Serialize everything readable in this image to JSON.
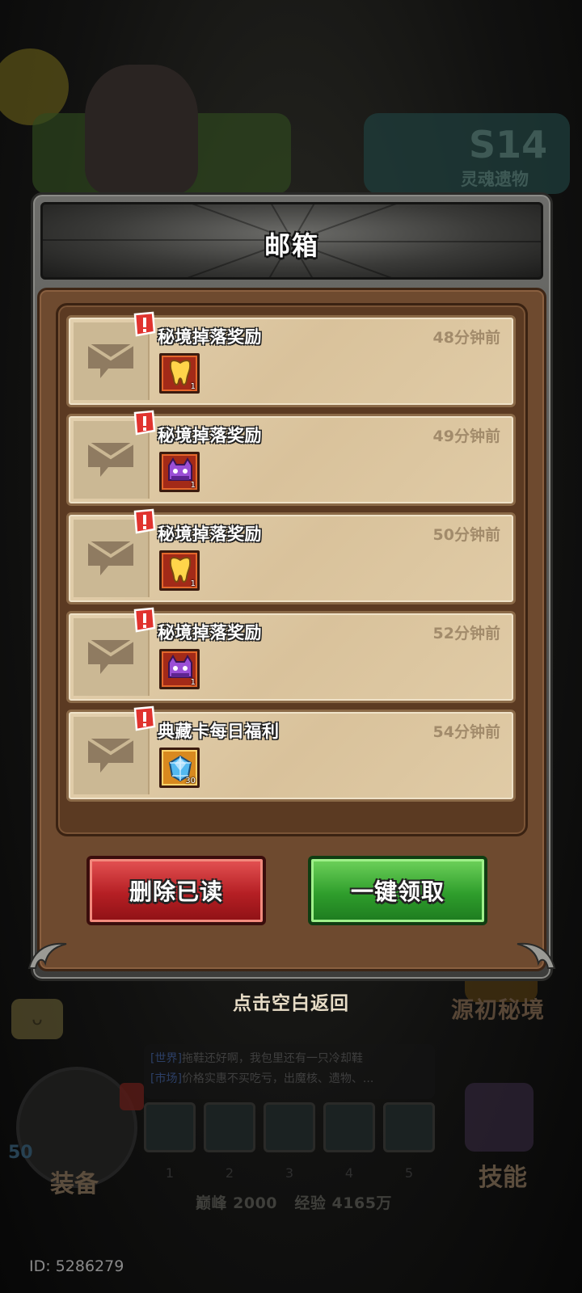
{
  "background": {
    "season": {
      "number": "S14",
      "subtitle": "灵魂遗物"
    },
    "realm_label": "源初秘境",
    "chat": [
      {
        "channel": "[世界]",
        "text": "拖鞋还好啊，我包里还有一只冷却鞋"
      },
      {
        "channel": "[市场]",
        "text": "价格实惠不买吃亏，出魔核、遗物、..."
      }
    ],
    "hero_level": "50",
    "equip_label": "装备",
    "slot_numbers": [
      "1",
      "2",
      "3",
      "4",
      "5"
    ],
    "stats": {
      "peak_label": "巅峰",
      "peak_value": "2000",
      "exp_label": "经验",
      "exp_value": "4165万"
    },
    "skill_label": "技能",
    "user_id": "ID: 5286279"
  },
  "mailbox": {
    "title": "邮箱",
    "mails": [
      {
        "title": "秘境掉落奖励",
        "time": "48分钟前",
        "reward": {
          "icon": "golden-tooth-icon",
          "count": "1",
          "frame": "red"
        }
      },
      {
        "title": "秘境掉落奖励",
        "time": "49分钟前",
        "reward": {
          "icon": "purple-cat-box-icon",
          "count": "1",
          "frame": "red"
        }
      },
      {
        "title": "秘境掉落奖励",
        "time": "50分钟前",
        "reward": {
          "icon": "golden-tooth-icon",
          "count": "1",
          "frame": "red"
        }
      },
      {
        "title": "秘境掉落奖励",
        "time": "52分钟前",
        "reward": {
          "icon": "purple-cat-box-icon",
          "count": "1",
          "frame": "red"
        }
      },
      {
        "title": "典藏卡每日福利",
        "time": "54分钟前",
        "reward": {
          "icon": "blue-gem-icon",
          "count": "30",
          "frame": "gold"
        }
      }
    ],
    "delete_read_label": "删除已读",
    "claim_all_label": "一键领取",
    "dismiss_hint": "点击空白返回"
  },
  "colors": {
    "panel_brown": "#6e4a2f",
    "paper": "#e3d0ae",
    "delete_red": "#b51f24",
    "claim_green": "#2f9e2c",
    "alert_red": "#e0332f"
  }
}
